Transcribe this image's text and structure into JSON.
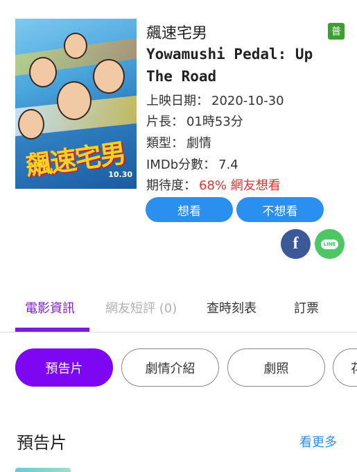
{
  "movie": {
    "title_zh": "飆速宅男",
    "title_en": "Yowamushi Pedal: Up The Road",
    "rating_badge": "普",
    "poster_logo": "飆速宅男",
    "poster_date": "10.30",
    "info": [
      {
        "label": "上映日期：",
        "value": "2020-10-30"
      },
      {
        "label": "片長：",
        "value": "01時53分"
      },
      {
        "label": "類型：",
        "value": "劇情"
      },
      {
        "label": "IMDb分數：",
        "value": "7.4"
      },
      {
        "label": "期待度：",
        "value": "68% 網友想看"
      }
    ]
  },
  "actions": {
    "want": "想看",
    "not_want": "不想看"
  },
  "share": {
    "facebook": "f",
    "line": "LINE"
  },
  "tabs": [
    {
      "label": "電影資訊",
      "active": true
    },
    {
      "label": "網友短評 (0)",
      "active": false
    },
    {
      "label": "查時刻表",
      "active": false
    },
    {
      "label": "訂票",
      "active": false
    }
  ],
  "chips": [
    {
      "label": "預告片",
      "active": true
    },
    {
      "label": "劇情介紹",
      "active": false
    },
    {
      "label": "劇照",
      "active": false
    },
    {
      "label": "花",
      "active": false
    }
  ],
  "section": {
    "title": "預告片",
    "more": "看更多"
  },
  "colors": {
    "accent_purple": "#7d07f2",
    "button_blue": "#2b8ff0",
    "rating_green": "#3aa12f",
    "hot_red": "#e0332c"
  }
}
